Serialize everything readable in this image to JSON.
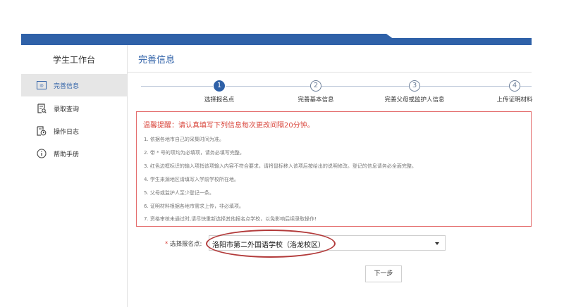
{
  "sidebar": {
    "title": "学生工作台",
    "items": [
      {
        "label": "完善信息",
        "icon": "id-card-icon",
        "active": true
      },
      {
        "label": "录取查询",
        "icon": "document-search-icon",
        "active": false
      },
      {
        "label": "操作日志",
        "icon": "log-clock-icon",
        "active": false
      },
      {
        "label": "帮助手册",
        "icon": "info-circle-icon",
        "active": false
      }
    ]
  },
  "main": {
    "title": "完善信息",
    "steps": [
      {
        "number": "1",
        "label": "选择报名点",
        "state": "active"
      },
      {
        "number": "2",
        "label": "完善基本信息",
        "state": "pending"
      },
      {
        "number": "3",
        "label": "完善父母或监护人信息",
        "state": "pending"
      },
      {
        "number": "4",
        "label": "上传证明材料",
        "state": "pending"
      }
    ],
    "notice": {
      "title": "温馨提醒：请认真填写下列信息每次更改间隔20分钟。",
      "items": [
        "1. 依据各地市自己的采集时间为准。",
        "2. 带 * 号的项均为必填项，请务必填写完整。",
        "3. 红色边框标识的输入项指该项输入内容不符合要求，请将鼠标移入该项后按给出的说明修改。登记的信息请务必全面完整。",
        "4. 学生来源地区请填写入学前学校所在地。",
        "5. 父母或监护人至少登记一条。",
        "6. 证明材料根据各地市需求上传，非必填项。",
        "7. 资格审核未通过时,请尽快重新选择其他报名点学校，以免影响后续录取操作!"
      ]
    },
    "form": {
      "required_mark": "*",
      "field_label": "选择报名点:",
      "selected_value": "洛阳市第二外国语学校（洛龙校区）"
    },
    "next_button_label": "下一步"
  },
  "colors": {
    "header_blue": "#2f61a8",
    "notice_red": "#d9473d",
    "highlight_ring": "#b23a3a"
  }
}
